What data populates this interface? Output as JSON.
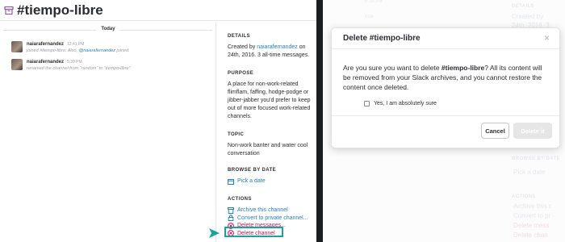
{
  "channel": {
    "name": "#tiempo-libre"
  },
  "messages": {
    "day_label": "Today",
    "items": [
      {
        "author": "naiarafernandez",
        "time": "12:41 PM",
        "text_pre": "joined #tiempo-libre. Also, ",
        "mention": "@naiarafernandez",
        "text_post": " joined."
      },
      {
        "author": "naiarafernandez",
        "time": "5:39 PM",
        "text": "renamed the channel from \"random\" to \"tiempo-libre\""
      }
    ]
  },
  "details": {
    "heading": "DETAILS",
    "created_pre": "Created by ",
    "creator": "naiarafernandez",
    "created_post": " on",
    "created_line2": "24th, 2016. 3 all-time messages."
  },
  "purpose": {
    "heading": "PURPOSE",
    "lines": [
      "A place for non-work-related",
      "flimflam, faffing, hodge-podge or",
      "jibber-jabber you'd prefer to keep",
      "out of more focused work-related",
      "channels."
    ]
  },
  "topic": {
    "heading": "TOPIC",
    "lines": [
      "Non-work banter and water cool",
      "conversation"
    ]
  },
  "browse": {
    "heading": "BROWSE BY DATE",
    "pick": "Pick a date"
  },
  "actions": {
    "heading": "ACTIONS",
    "archive": "Archive this channel",
    "convert": "Convert to private channel...",
    "delete_messages": "Delete messages...",
    "delete_channel": "Delete channel"
  },
  "right_ghost": {
    "details": "DETAILS",
    "created_by": "Created by",
    "line2": "24th, 2016. 3",
    "purpose": "PURPOSE",
    "purpose_lines": [
      "A place for n",
      "flimflam, faff",
      "jibber-jabber",
      "out of more f",
      "channels."
    ],
    "topic": "TOPIC",
    "topic_lines": [
      "Non-work ban",
      "conversation"
    ],
    "browse": "BROWSE BY DATE",
    "pick": "Pick a date",
    "actions": "ACTIONS",
    "archive": "Archive this c",
    "convert": "Convert to pr",
    "delete_messages": "Delete mess",
    "delete_channel": "Delete chan"
  },
  "modal": {
    "title": "Delete #tiempo-libre",
    "close": "×",
    "text_pre": "Are you sure you want to delete ",
    "text_channel": "#tiempo-libre",
    "text_post": "? All its content will be removed from your Slack archives, and you cannot restore the content once deleted.",
    "confirm_label": "Yes, I am absolutely sure",
    "cancel": "Cancel",
    "delete": "Delete it"
  },
  "colors": {
    "link": "#2a80b9",
    "danger": "#c2185b",
    "highlight": "#1aa39a",
    "divider": "#1a1d21"
  }
}
